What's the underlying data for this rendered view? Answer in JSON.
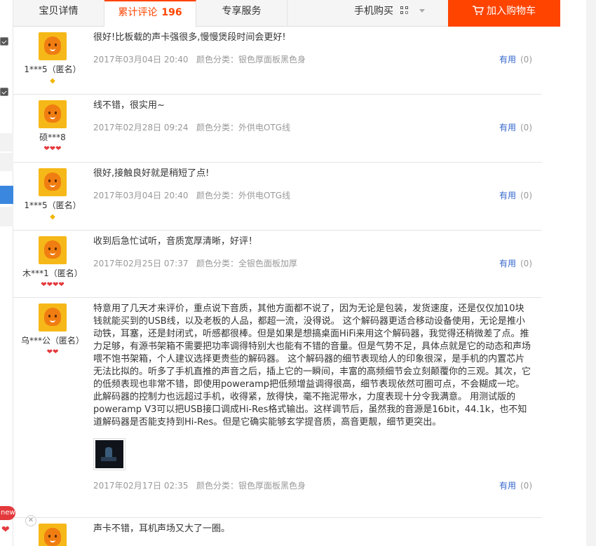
{
  "tabs": {
    "details": "宝贝详情",
    "reviews": "累计评论",
    "review_count": "196",
    "service": "专享服务"
  },
  "mobile_buy": "手机购买",
  "cart_button": "加入购物车",
  "useful_label": "有用",
  "reviews": [
    {
      "user": "1***5（匿名）",
      "rank": "◆",
      "text": "很好!比板载的声卡强很多,慢慢煲段时间会更好!",
      "date": "2017年03月04日 20:40",
      "attr": "颜色分类：银色厚面板黑色身",
      "useful_count": "(0)"
    },
    {
      "user": "硕***8",
      "rank": "❤❤❤",
      "text": "线不错，很实用~",
      "date": "2017年02月28日 09:24",
      "attr": "颜色分类：外供电OTG线",
      "useful_count": "(0)"
    },
    {
      "user": "1***5（匿名）",
      "rank": "◆",
      "text": "很好,接触良好就是稍短了点!",
      "date": "2017年03月04日 20:40",
      "attr": "颜色分类：外供电OTG线",
      "useful_count": "(0)"
    },
    {
      "user": "木***1（匿名）",
      "rank": "❤❤❤❤",
      "text": "收到后急忙试听，音质宽厚清晰，好评！",
      "date": "2017年02月25日 07:37",
      "attr": "颜色分类：全银色面板加厚",
      "useful_count": "(0)"
    },
    {
      "user": "乌***公（匿名）",
      "rank": "❤❤",
      "text": "特意用了几天才来评价，重点说下音质，其他方面都不说了，因为无论是包装，发货速度，还是仅仅加10块钱就能买到的USB线，以及老板的人品，都超一流，没得说。 这个解码器更适合移动设备使用，无论是推小动铁，耳塞，还是封闭式，听感都很棒。但是如果是想搞桌面HiFi来用这个解码器，我觉得还稍微差了点。推力足够，有源书架箱不需要把功率调得特别大也能有不错的音量。但是气势不足，具体点就是它的动态和声场喂不饱书架箱，个人建议选择更贵些的解码器。 这个解码器的细节表现给人的印象很深，是手机的内置芯片无法比拟的。听多了手机直推的声音之后，插上它的一瞬间，丰富的高频细节会立刻颠覆你的三观。其次，它的低频表现也非常不错，即使用poweramp把低频增益调得很高，细节表现依然可圈可点，不会糊成一坨。此解码器的控制力也远超过手机，收得紧，放得快，毫不拖泥带水，力度表现十分令我满意。 用测试版的poweramp V3可以把USB接口调成Hi-Res格式输出。这样调节后，虽然我的音源是16bit，44.1k，也不知道解码器是否能支持到Hi-Res。但是它确实能够玄学提音质，高音更靓，细节更突出。",
      "date": "2017年02月17日 02:35",
      "attr": "颜色分类：银色厚面板黑色身",
      "useful_count": "(0)"
    },
    {
      "user": "",
      "rank": "",
      "text": "声卡不错，耳机声场又大了一圈。",
      "date": "",
      "attr": "",
      "useful_count": ""
    }
  ],
  "sidebar": {
    "new_badge": "new"
  }
}
